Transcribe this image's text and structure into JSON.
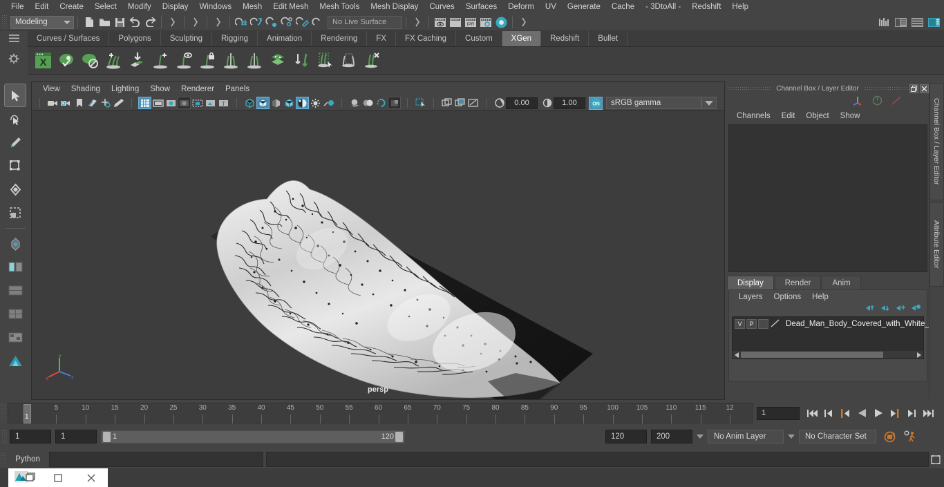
{
  "app": {
    "menus": [
      "File",
      "Edit",
      "Create",
      "Select",
      "Modify",
      "Display",
      "Windows",
      "Mesh",
      "Edit Mesh",
      "Mesh Tools",
      "Mesh Display",
      "Curves",
      "Surfaces",
      "Deform",
      "UV",
      "Generate",
      "Cache",
      "- 3DtoAll -",
      "Redshift",
      "Help"
    ],
    "menu_set": "Modeling",
    "live_surface": "No Live Surface"
  },
  "shelf": {
    "tabs": [
      "Curves / Surfaces",
      "Polygons",
      "Sculpting",
      "Rigging",
      "Animation",
      "Rendering",
      "FX",
      "FX Caching",
      "Custom",
      "XGen",
      "Redshift",
      "Bullet"
    ],
    "active_tab": "XGen",
    "icons": [
      "xgen-editor-icon",
      "xgen-preview-icon",
      "xgen-disable-preview-icon",
      "xgen-add-description-icon",
      "xgen-import-collection-icon",
      "xgen-add-guide-icon",
      "xgen-guide-visibility-icon",
      "xgen-lock-guide-icon",
      "xgen-mirror-guide-icon",
      "xgen-multi-guide-icon",
      "xgen-layer-icon",
      "xgen-convert-guide-icon",
      "xgen-select-primitives-icon",
      "xgen-region-mask-icon",
      "xgen-delete-guide-icon"
    ]
  },
  "toolbox": {
    "tools": [
      "select-tool",
      "lasso-select-tool",
      "paint-select-tool",
      "move-tool",
      "rotate-tool",
      "scale-tool",
      "soft-select-tool",
      "show-manip-tool",
      "last-tool",
      "outliner-layout-icon",
      "persp-layout-icon",
      "four-view-layout-icon",
      "hypershade-layout-icon"
    ]
  },
  "viewport": {
    "menus": [
      "View",
      "Shading",
      "Lighting",
      "Show",
      "Renderer",
      "Panels"
    ],
    "camera_label": "persp",
    "exposure_value": "0.00",
    "gamma_value": "1.00",
    "color_management": "sRGB gamma",
    "color_mgmt_toggle": "ON",
    "toolbar_icons": [
      "camera-icon",
      "camera-attributes-icon",
      "bookmark-icon",
      "image-plane-icon",
      "two-d-pan-zoom-icon",
      "grease-pencil-icon",
      "grid-toggle-icon",
      "film-gate-icon",
      "resolution-gate-icon",
      "gate-mask-icon",
      "field-chart-icon",
      "safe-action-icon",
      "safe-title-icon",
      "wireframe-icon",
      "smooth-shade-all-icon",
      "shade-selected-icon",
      "wireframe-on-shaded-icon",
      "xray-icon",
      "xray-joints-icon",
      "lighting-icon",
      "shadows-icon",
      "screen-space-ao-icon",
      "motion-blur-icon",
      "multisample-icon",
      "depth-of-field-icon",
      "isolate-select-icon",
      "single-pane-icon",
      "two-pane-icon",
      "four-pane-icon",
      "exposure-icon",
      "gamma-icon"
    ]
  },
  "channel_box": {
    "title": "Channel Box / Layer Editor",
    "menus": [
      "Channels",
      "Edit",
      "Object",
      "Show"
    ],
    "window_buttons": [
      "restore-icon",
      "close-icon"
    ]
  },
  "layer_editor": {
    "tabs": [
      "Display",
      "Render",
      "Anim"
    ],
    "active_tab": "Display",
    "menus": [
      "Layers",
      "Options",
      "Help"
    ],
    "buttons": [
      "move-layer-up-icon",
      "move-layer-down-icon",
      "new-layer-icon",
      "new-layer-from-selected-icon"
    ],
    "layers": [
      {
        "visibility": "V",
        "playback": "P",
        "state": "",
        "name": "Dead_Man_Body_Covered_with_White_Sh"
      }
    ]
  },
  "sidebar_tabs": [
    "Channel Box / Layer Editor",
    "Attribute Editor"
  ],
  "timeline": {
    "tick_labels": [
      "5",
      "10",
      "15",
      "20",
      "25",
      "30",
      "35",
      "40",
      "45",
      "50",
      "55",
      "60",
      "65",
      "70",
      "75",
      "80",
      "85",
      "90",
      "95",
      "100",
      "105",
      "110",
      "115",
      "12"
    ],
    "current_frame_label": "1",
    "current_frame_field": "1",
    "playback_buttons": [
      "go-to-start-icon",
      "step-back-keyframe-icon",
      "step-back-frame-icon",
      "play-backwards-icon",
      "play-forwards-icon",
      "step-forward-frame-icon",
      "step-forward-keyframe-icon",
      "go-to-end-icon"
    ]
  },
  "range": {
    "anim_start": "1",
    "playback_start": "1",
    "bar_left_label": "1",
    "bar_right_label": "120",
    "playback_end": "120",
    "anim_end": "200",
    "anim_layer": "No Anim Layer",
    "character_set": "No Character Set",
    "auto_key_icon": "auto-keyframe-icon",
    "prefs_icon": "animation-preferences-icon"
  },
  "command_line": {
    "language_label": "Python",
    "input_value": "",
    "result_value": ""
  },
  "taskbar": {
    "items": [
      "app-thumbnail-icon",
      "restore-window-icon",
      "maximize-window-icon",
      "close-window-icon"
    ]
  },
  "colors": {
    "accent_teal": "#4ab0c8",
    "xgen_green": "#62a860",
    "panel_bg": "#444444",
    "viewport_bg": "#3d3d3d",
    "highlight_blue": "#4e91b8",
    "orange": "#d07828"
  }
}
